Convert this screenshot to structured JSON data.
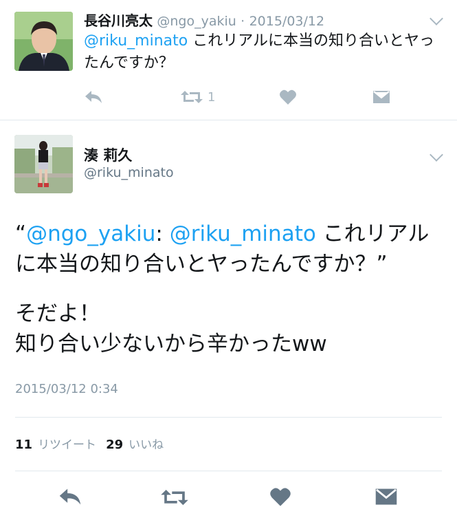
{
  "tweet1": {
    "display_name": "長谷川亮太",
    "handle": "@ngo_yakiu",
    "separator": "·",
    "date": "2015/03/12",
    "mention": "@riku_minato",
    "text": " これリアルに本当の知り合いとヤったんですか？",
    "retweet_count": "1",
    "icons": [
      "reply-icon",
      "retweet-icon",
      "like-icon",
      "dm-icon",
      "chevron-down-icon"
    ]
  },
  "tweet2": {
    "display_name": "湊 莉久",
    "handle": "@riku_minato",
    "quote_open": "“",
    "quote_mention1": "@ngo_yakiu",
    "quote_colon": ": ",
    "quote_mention2": "@riku_minato",
    "quote_text": " これリアルに本当の知り合いとヤったんですか？",
    "quote_close": "”",
    "reply_line1": "そだよ！",
    "reply_line2": "知り合い少ないから辛かったww",
    "timestamp": "2015/03/12 0:34",
    "retweets_num": "11",
    "retweets_label": "リツイート",
    "likes_num": "29",
    "likes_label": "いいね",
    "icons": [
      "reply-icon",
      "retweet-icon",
      "like-icon",
      "dm-icon",
      "chevron-down-icon"
    ]
  },
  "colors": {
    "mention": "#1da1f2",
    "icon_gray": "#aab8c2",
    "icon_dark": "#657786",
    "meta_gray": "#8899a6",
    "divider": "#e1e8ed"
  }
}
